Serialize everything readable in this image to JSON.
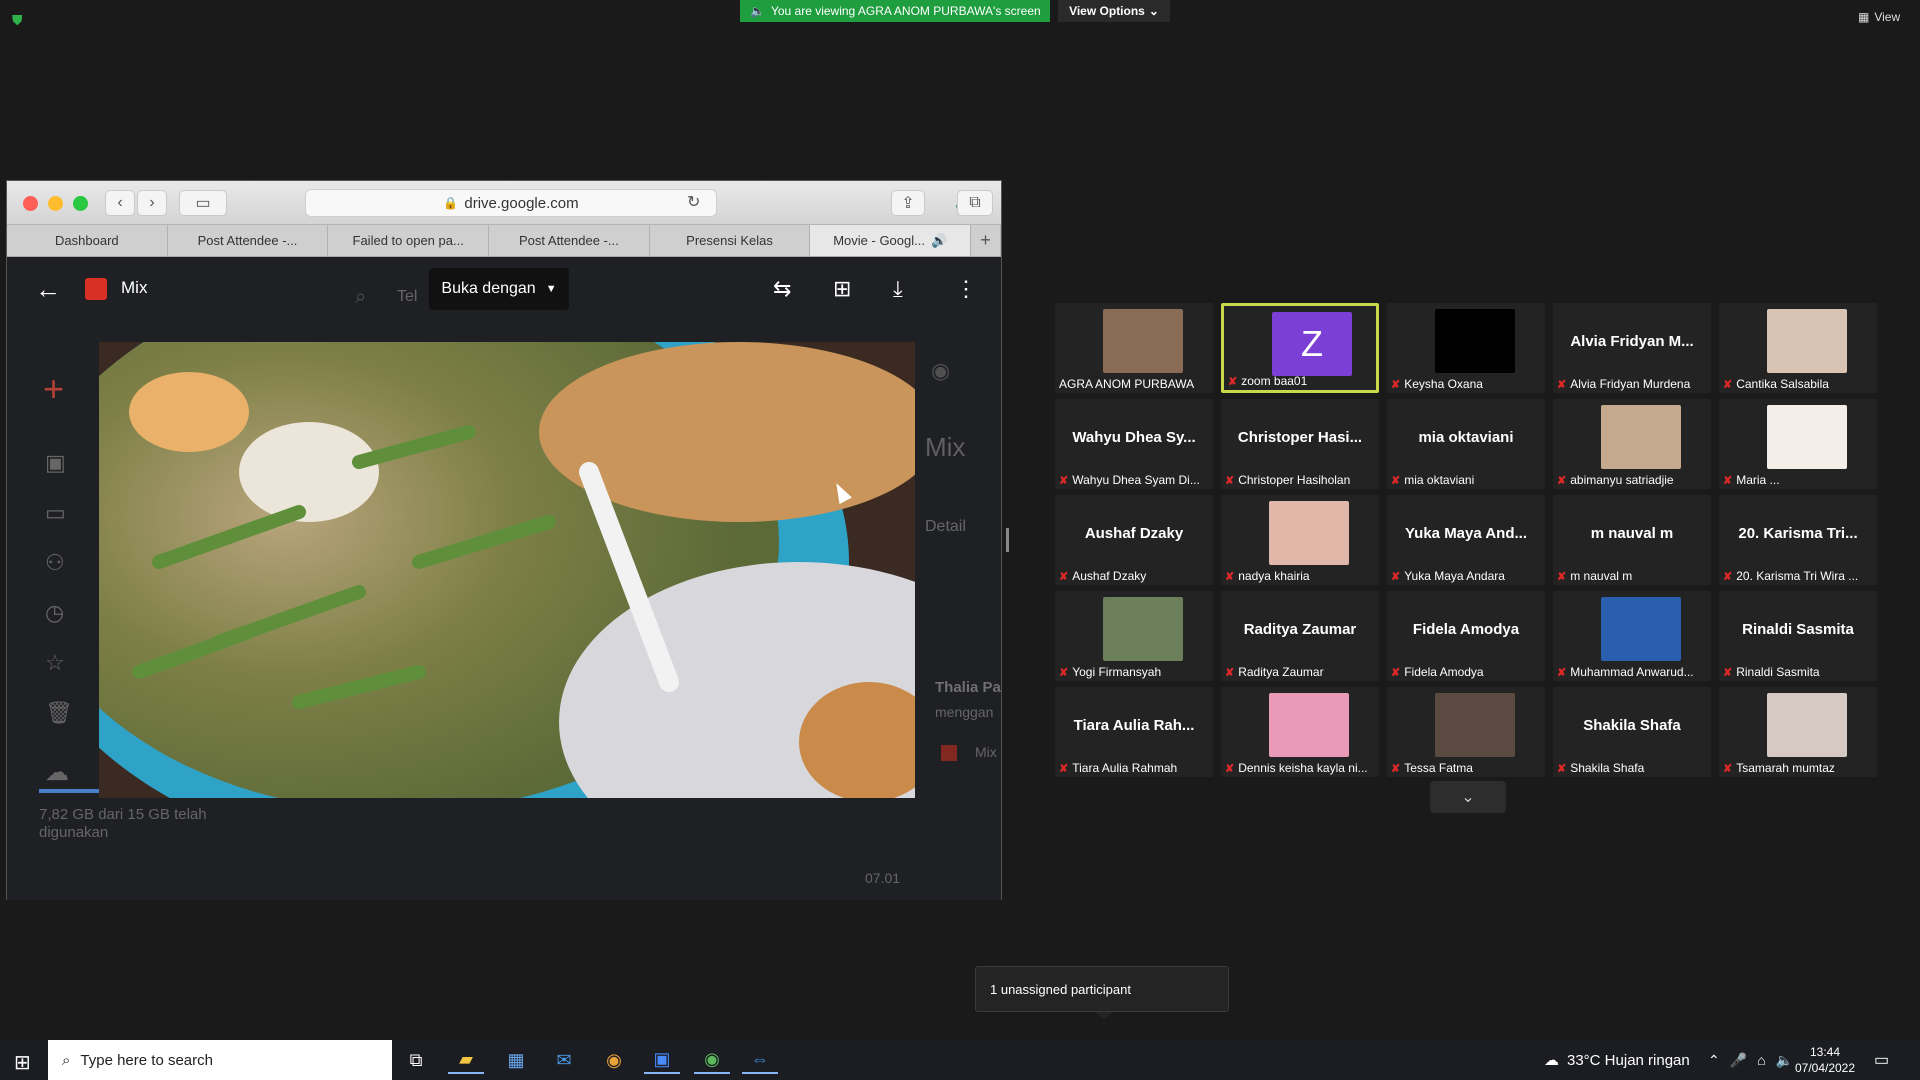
{
  "zoom": {
    "banner_text": "You are viewing AGRA ANOM PURBAWA's screen",
    "view_options_label": "View Options",
    "view_label": "View",
    "unassigned_text": "1 unassigned participant"
  },
  "browser": {
    "url": "drive.google.com",
    "tabs": [
      "Dashboard",
      "Post Attendee -...",
      "Failed to open pa...",
      "Post Attendee -...",
      "Presensi Kelas",
      "Movie - Googl..."
    ],
    "new_tab_label": "+"
  },
  "drive": {
    "file_name": "Mix",
    "open_with_label": "Buka dengan",
    "bg_title": "Mix",
    "bg_detail": "Detail",
    "bg_activity_user": "Thalia Pa",
    "bg_activity_text": "menggan",
    "bg_mix_label": "Mix",
    "storage_text": "7,82 GB dari 15 GB telah digunakan",
    "bg_date": "07.01",
    "bg_search_hint": "Tel",
    "storage_fraction": 0.52
  },
  "participants": [
    {
      "display": "",
      "name": "AGRA ANOM PURBAWA",
      "photo": "#8a6b55",
      "muted": false
    },
    {
      "display": "Z",
      "name": "zoom baa01",
      "photo": "#7b3fd6",
      "muted": true,
      "active": true
    },
    {
      "display": "",
      "name": "Keysha Oxana",
      "photo": "#000000",
      "muted": true
    },
    {
      "display": "Alvia Fridyan M...",
      "name": "Alvia Fridyan Murdena",
      "muted": true
    },
    {
      "display": "",
      "name": "Cantika Salsabila",
      "photo": "#d9c3b2",
      "muted": true
    },
    {
      "display": "Wahyu Dhea Sy...",
      "name": "Wahyu Dhea Syam Di...",
      "muted": true
    },
    {
      "display": "Christoper Hasi...",
      "name": "Christoper Hasiholan",
      "muted": true
    },
    {
      "display": "mia oktaviani",
      "name": "mia oktaviani",
      "muted": true
    },
    {
      "display": "",
      "name": "abimanyu satriadjie",
      "photo": "#c4a98f",
      "muted": true
    },
    {
      "display": "",
      "name": "Maria ...",
      "photo": "#f3eee8",
      "muted": true
    },
    {
      "display": "Aushaf Dzaky",
      "name": "Aushaf Dzaky",
      "muted": true
    },
    {
      "display": "",
      "name": "nadya khairia",
      "photo": "#e0b7a8",
      "muted": true
    },
    {
      "display": "Yuka Maya And...",
      "name": "Yuka Maya Andara",
      "muted": true
    },
    {
      "display": "m nauval m",
      "name": "m nauval m",
      "muted": true
    },
    {
      "display": "20. Karisma Tri...",
      "name": "20. Karisma Tri Wira ...",
      "muted": true
    },
    {
      "display": "",
      "name": "Yogi Firmansyah",
      "photo": "#6b7f5a",
      "muted": true
    },
    {
      "display": "Raditya Zaumar",
      "name": "Raditya Zaumar",
      "muted": true
    },
    {
      "display": "Fidela Amodya",
      "name": "Fidela Amodya",
      "muted": true
    },
    {
      "display": "",
      "name": "Muhammad Anwarud...",
      "photo": "#2a5fb0",
      "muted": true
    },
    {
      "display": "Rinaldi Sasmita",
      "name": "Rinaldi Sasmita",
      "muted": true
    },
    {
      "display": "Tiara Aulia Rah...",
      "name": "Tiara Aulia Rahmah",
      "muted": true
    },
    {
      "display": "",
      "name": "Dennis keisha kayla ni...",
      "photo": "#e89ab8",
      "muted": true
    },
    {
      "display": "",
      "name": "Tessa Fatma",
      "photo": "#5a4a42",
      "muted": true
    },
    {
      "display": "Shakila Shafa",
      "name": "Shakila Shafa",
      "muted": true
    },
    {
      "display": "",
      "name": "Tsamarah mumtaz",
      "photo": "#d6c9c4",
      "muted": true
    }
  ],
  "taskbar": {
    "search_placeholder": "Type here to search",
    "weather": "33°C  Hujan ringan",
    "time": "13:44",
    "date": "07/04/2022"
  },
  "colors": {
    "banner": "#1e9e3e",
    "active_speaker": "#c7d94a",
    "muted_mic": "#e02828"
  }
}
